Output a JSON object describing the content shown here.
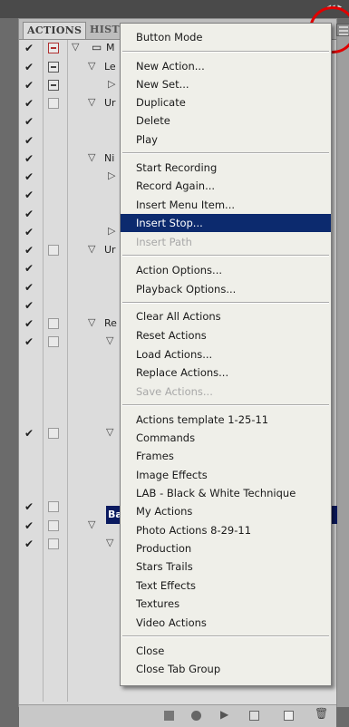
{
  "panel": {
    "tabs": [
      {
        "label": "ACTIONS"
      },
      {
        "label": "HIST"
      }
    ],
    "visible_row_text": {
      "row0": "M",
      "row1": "Le",
      "row3": "Ur",
      "row6": "Ni",
      "row11": "Ur",
      "row15": "Re",
      "row26": "Ba"
    }
  },
  "menu": {
    "items": [
      {
        "label": "Button Mode"
      },
      {
        "label": "New Action..."
      },
      {
        "label": "New Set..."
      },
      {
        "label": "Duplicate"
      },
      {
        "label": "Delete"
      },
      {
        "label": "Play"
      },
      {
        "label": "Start Recording"
      },
      {
        "label": "Record Again..."
      },
      {
        "label": "Insert Menu Item..."
      },
      {
        "label": "Insert Stop..."
      },
      {
        "label": "Insert Path"
      },
      {
        "label": "Action Options..."
      },
      {
        "label": "Playback Options..."
      },
      {
        "label": "Clear All Actions"
      },
      {
        "label": "Reset Actions"
      },
      {
        "label": "Load Actions..."
      },
      {
        "label": "Replace Actions..."
      },
      {
        "label": "Save Actions..."
      },
      {
        "label": "Actions template 1-25-11"
      },
      {
        "label": "Commands"
      },
      {
        "label": "Frames"
      },
      {
        "label": "Image Effects"
      },
      {
        "label": "LAB - Black & White Technique"
      },
      {
        "label": "My Actions"
      },
      {
        "label": "Photo Actions 8-29-11"
      },
      {
        "label": "Production"
      },
      {
        "label": "Stars Trails"
      },
      {
        "label": "Text Effects"
      },
      {
        "label": "Textures"
      },
      {
        "label": "Video Actions"
      },
      {
        "label": "Close"
      },
      {
        "label": "Close Tab Group"
      }
    ],
    "highlighted": "Insert Stop...",
    "disabled": [
      "Insert Path",
      "Save Actions..."
    ]
  },
  "colors": {
    "highlight": "#0c2a6e",
    "annotation_circle": "#e00000",
    "menu_bg": "#efefe9"
  }
}
